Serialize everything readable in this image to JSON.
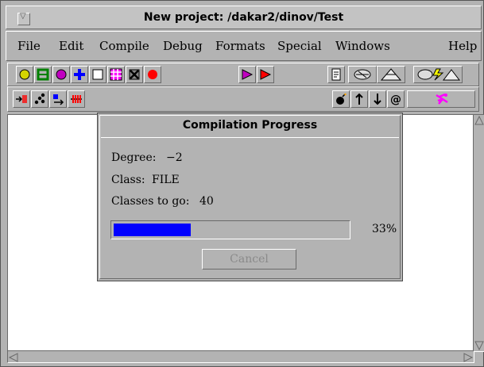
{
  "window": {
    "title": "New project: /dakar2/dinov/Test"
  },
  "menubar": [
    {
      "label": "File"
    },
    {
      "label": "Edit"
    },
    {
      "label": "Compile"
    },
    {
      "label": "Debug"
    },
    {
      "label": "Formats"
    },
    {
      "label": "Special"
    },
    {
      "label": "Windows"
    },
    {
      "label": "Help"
    }
  ],
  "toolbar_icons": [
    "yellow-circle-icon",
    "green-frame-icon",
    "purple-circle-icon",
    "blue-plus-icon",
    "empty-box-icon",
    "grid-icon",
    "crossed-box-icon",
    "red-dot-icon",
    "purple-play-icon",
    "red-play-icon",
    "document-icon",
    "shell-icon",
    "pyramid-icon",
    "lightning-icon",
    "shell-pyramid-icon"
  ],
  "toolbar2_icons": [
    "red-arrow-bar-icon",
    "dots-icon",
    "blue-arrow-icon",
    "red-grid-icon",
    "bomb-icon",
    "up-arrow-icon",
    "down-arrow-icon",
    "at-icon",
    "magenta-runner-icon"
  ],
  "dialog": {
    "title": "Compilation Progress",
    "degree_label": "Degree:",
    "degree_value": "−2",
    "class_label": "Class:",
    "class_value": "FILE",
    "classes_to_go_label": "Classes to go:",
    "classes_to_go_value": "40",
    "progress": 0.33,
    "progress_text": "33%",
    "cancel_label": "Cancel"
  },
  "colors": {
    "progress_fill": "#0000ff",
    "chrome": "#b3b3b3",
    "canvas": "#ffffff"
  }
}
